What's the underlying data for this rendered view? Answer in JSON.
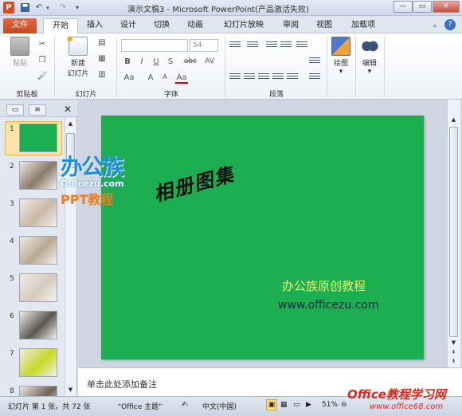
{
  "window": {
    "title": "演示文稿3 - Microsoft PowerPoint(产品激活失败)",
    "controls": [
      "—",
      "▭",
      "✕"
    ]
  },
  "tabs": [
    {
      "label": "文件"
    },
    {
      "label": "开始"
    },
    {
      "label": "插入"
    },
    {
      "label": "设计"
    },
    {
      "label": "切换"
    },
    {
      "label": "动画"
    },
    {
      "label": "幻灯片放映"
    },
    {
      "label": "审阅"
    },
    {
      "label": "视图"
    },
    {
      "label": "加载项"
    }
  ],
  "ribbon": {
    "clipboard": {
      "paste": "粘贴",
      "group": "剪贴板"
    },
    "slides": {
      "new_slide_line1": "新建",
      "new_slide_line2": "幻灯片",
      "group": "幻灯片"
    },
    "font": {
      "size": "54",
      "group": "字体",
      "buttons": [
        "B",
        "I",
        "U",
        "S",
        "abc",
        "AV",
        "Aa",
        "A",
        "A",
        "Aa"
      ]
    },
    "paragraph": {
      "group": "段落"
    },
    "drawing": {
      "label": "绘图"
    },
    "editing": {
      "label": "编辑"
    }
  },
  "thumbnails": [
    {
      "num": "1",
      "color": "#1eae52"
    },
    {
      "num": "2",
      "color": "#8a7a6a"
    },
    {
      "num": "3",
      "color": "#c9b8a6"
    },
    {
      "num": "4",
      "color": "#b8a993"
    },
    {
      "num": "5",
      "color": "#d6cabf"
    },
    {
      "num": "6",
      "color": "#5c5750"
    },
    {
      "num": "7",
      "color": "#c8d826"
    },
    {
      "num": "8",
      "color": "#6e6256"
    }
  ],
  "slide": {
    "title": "相册图集",
    "subtitle": "办公族原创教程",
    "url": "www.officezu.com",
    "background": "#1eae52"
  },
  "notes": {
    "placeholder": "单击此处添加备注"
  },
  "status": {
    "slide_info": "幻灯片 第 1 张，共 72 张",
    "theme": "\"Office 主题\"",
    "language": "中文(中国)",
    "zoom": "51%"
  },
  "watermarks": {
    "logo_text": "办公族",
    "logo_sub": "Officezu.com",
    "logo_sub2": "PPT教程",
    "bottom_right": "Office教程学习网",
    "bottom_right_url": "www.office68.com"
  }
}
